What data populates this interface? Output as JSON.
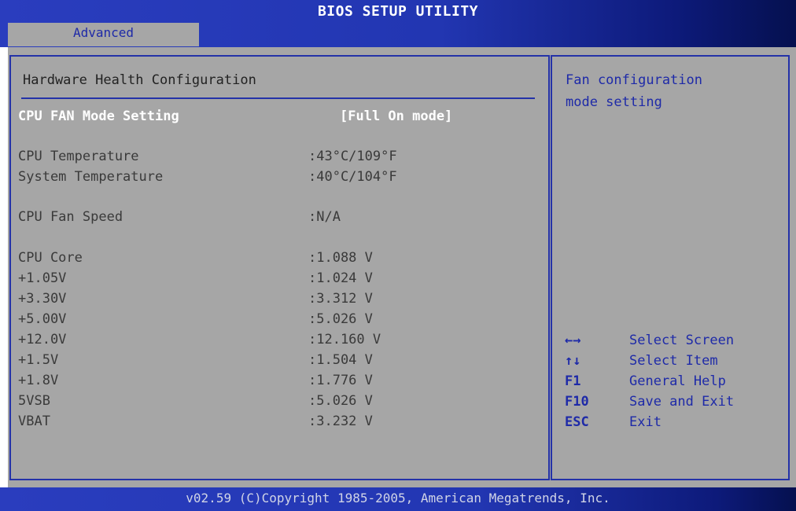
{
  "header": {
    "title": "BIOS SETUP UTILITY",
    "active_tab": "Advanced"
  },
  "main": {
    "section_title": "Hardware Health Configuration",
    "fan_mode": {
      "label": "CPU FAN Mode Setting",
      "value": "[Full On mode]"
    },
    "readings": [
      {
        "label": "CPU Temperature",
        "value": ":43°C/109°F"
      },
      {
        "label": "System Temperature",
        "value": ":40°C/104°F"
      },
      {
        "label": "CPU Fan Speed",
        "value": ":N/A"
      },
      {
        "label": "CPU Core",
        "value": ":1.088 V"
      },
      {
        "label": "+1.05V",
        "value": ":1.024 V"
      },
      {
        "label": "+3.30V",
        "value": ":3.312 V"
      },
      {
        "label": "+5.00V",
        "value": ":5.026 V"
      },
      {
        "label": "+12.0V",
        "value": ":12.160 V"
      },
      {
        "label": "+1.5V",
        "value": ":1.504 V"
      },
      {
        "label": "+1.8V",
        "value": ":1.776 V"
      },
      {
        "label": "5VSB",
        "value": ":5.026 V"
      },
      {
        "label": "VBAT",
        "value": ":3.232 V"
      }
    ]
  },
  "help": {
    "text": "Fan configuration\nmode setting",
    "keys": [
      {
        "key": "←→",
        "desc": "Select Screen"
      },
      {
        "key": "↑↓",
        "desc": "Select Item"
      },
      {
        "key": "F1",
        "desc": "General Help"
      },
      {
        "key": "F10",
        "desc": "Save and Exit"
      },
      {
        "key": "ESC",
        "desc": "Exit"
      }
    ]
  },
  "footer": {
    "copyright": "v02.59 (C)Copyright 1985-2005, American Megatrends, Inc."
  },
  "colors": {
    "background": "#a6a6a6",
    "accent": "#2432a8",
    "highlight": "#ffffff",
    "text": "#3a3a3a",
    "help_text": "#1e2aa8"
  }
}
